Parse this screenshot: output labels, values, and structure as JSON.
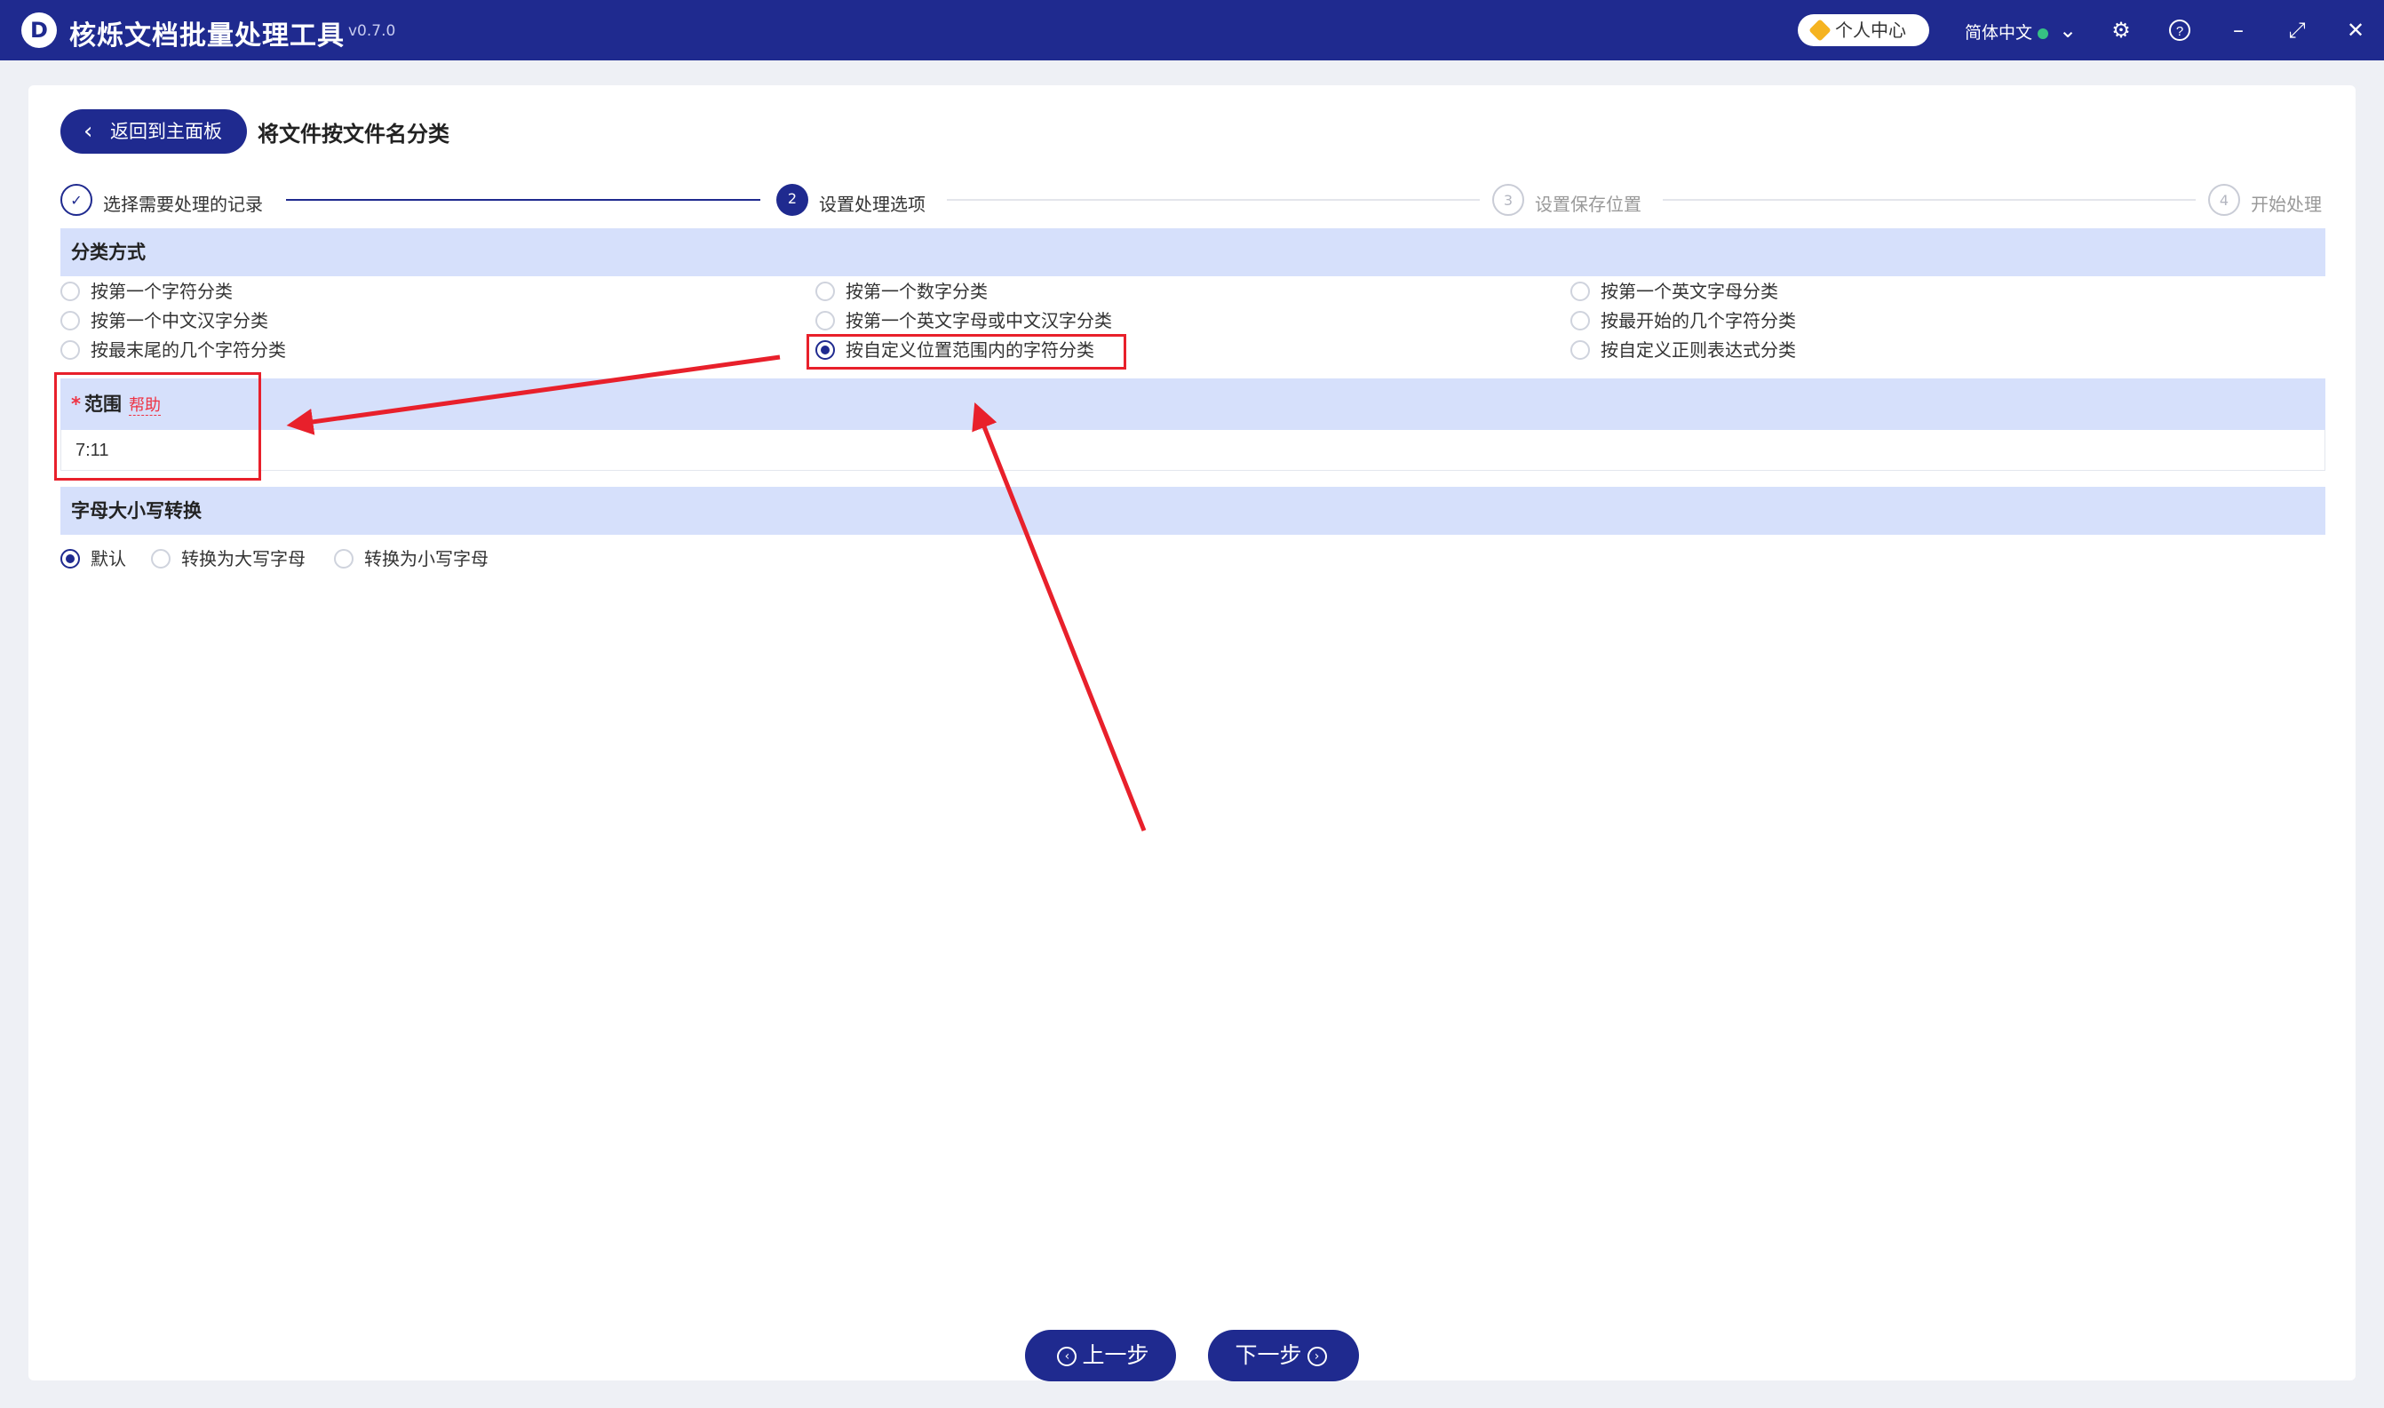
{
  "window": {
    "app_title": "核烁文档批量处理工具",
    "version": "v0.7.0",
    "user_center": "个人中心",
    "language": "简体中文",
    "icons": [
      "chevron-down-icon",
      "gear-icon",
      "help-icon",
      "minimize-icon",
      "maximize-icon",
      "close-icon"
    ]
  },
  "header": {
    "back_label": "返回到主面板",
    "page_title": "将文件按文件名分类"
  },
  "steps": [
    {
      "num": "✓",
      "label": "选择需要处理的记录",
      "state": "done"
    },
    {
      "num": "2",
      "label": "设置处理选项",
      "state": "active"
    },
    {
      "num": "3",
      "label": "设置保存位置",
      "state": "todo"
    },
    {
      "num": "4",
      "label": "开始处理",
      "state": "todo"
    }
  ],
  "classify": {
    "title": "分类方式",
    "options": [
      {
        "label": "按第一个字符分类",
        "checked": false
      },
      {
        "label": "按第一个数字分类",
        "checked": false
      },
      {
        "label": "按第一个英文字母分类",
        "checked": false
      },
      {
        "label": "按第一个中文汉字分类",
        "checked": false
      },
      {
        "label": "按第一个英文字母或中文汉字分类",
        "checked": false
      },
      {
        "label": "按最开始的几个字符分类",
        "checked": false
      },
      {
        "label": "按最末尾的几个字符分类",
        "checked": false
      },
      {
        "label": "按自定义位置范围内的字符分类",
        "checked": true
      },
      {
        "label": "按自定义正则表达式分类",
        "checked": false
      }
    ]
  },
  "range": {
    "required_mark": "*",
    "label": "范围",
    "help": "帮助",
    "value": "7:11"
  },
  "case": {
    "title": "字母大小写转换",
    "options": [
      {
        "label": "默认",
        "checked": true
      },
      {
        "label": "转换为大写字母",
        "checked": false
      },
      {
        "label": "转换为小写字母",
        "checked": false
      }
    ]
  },
  "footer": {
    "prev_label": "上一步",
    "next_label": "下一步"
  },
  "colors": {
    "primary": "#1f2a8f",
    "section_bg": "#d6e0fb",
    "annotation": "#e8202b"
  }
}
